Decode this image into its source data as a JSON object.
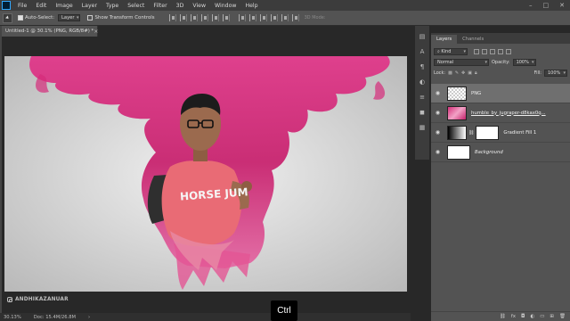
{
  "menubar": {
    "items": [
      "File",
      "Edit",
      "Image",
      "Layer",
      "Type",
      "Select",
      "Filter",
      "3D",
      "View",
      "Window",
      "Help"
    ]
  },
  "options": {
    "auto_select_label": "Auto-Select:",
    "auto_select_target": "Layer",
    "transform_controls_label": "Show Transform Controls",
    "mode_3d_label": "3D Mode:"
  },
  "document": {
    "tab_title": "Untitled-1 @ 30.1% (PNG, RGB/8#) *",
    "watermark": "ANDHIKAZANUAR",
    "subject_shirt_text": "HORSE JUM"
  },
  "status": {
    "zoom": "30.13%",
    "doc_size": "Doc: 15.4M/26.8M"
  },
  "overlay": {
    "key_hint": "Ctrl"
  },
  "layers_panel": {
    "tabs": [
      "Layers",
      "Channels"
    ],
    "filter_kind": "Kind",
    "blend_mode": "Normal",
    "opacity_label": "Opacity:",
    "opacity_value": "100%",
    "lock_label": "Lock:",
    "fill_label": "Fill:",
    "fill_value": "100%",
    "layers": [
      {
        "name": "PNG",
        "selected": true
      },
      {
        "name": "humble_by_jugraper-d8kax0q...",
        "selected": false
      },
      {
        "name": "Gradient Fill 1",
        "selected": false
      },
      {
        "name": "Background",
        "selected": false
      }
    ]
  },
  "colors": {
    "ink_pink": "#d8287a",
    "canvas_light": "#efefef",
    "canvas_dark": "#b9b9b9",
    "shirt": "#e96b75"
  }
}
